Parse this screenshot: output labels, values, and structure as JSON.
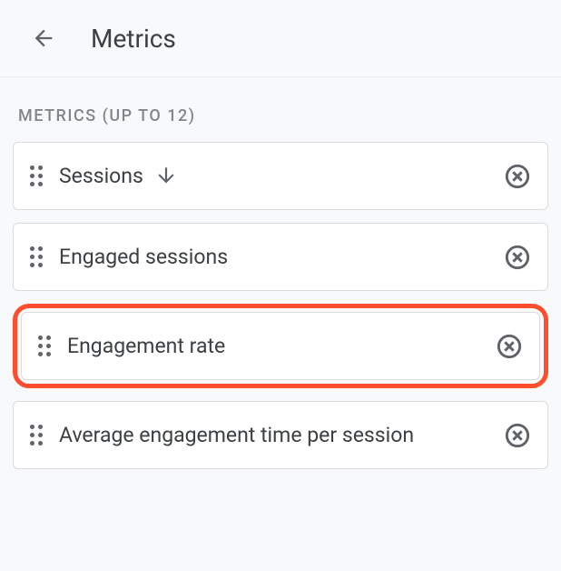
{
  "header": {
    "title": "Metrics"
  },
  "section": {
    "label": "METRICS (UP TO 12)"
  },
  "metrics": [
    {
      "label": "Sessions",
      "hasSort": true,
      "highlighted": false
    },
    {
      "label": "Engaged sessions",
      "hasSort": false,
      "highlighted": false
    },
    {
      "label": "Engagement rate",
      "hasSort": false,
      "highlighted": true
    },
    {
      "label": "Average engagement time per session",
      "hasSort": false,
      "highlighted": false
    }
  ]
}
